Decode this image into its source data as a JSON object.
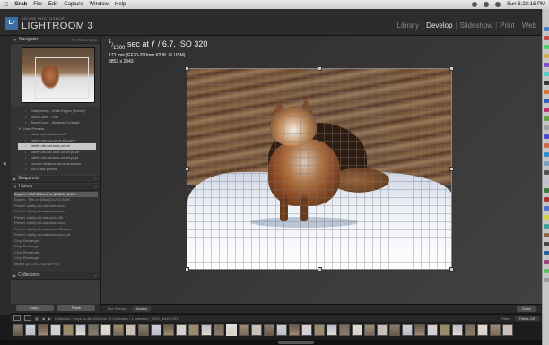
{
  "menubar": {
    "app_name": "Grab",
    "items": [
      "File",
      "Edit",
      "Capture",
      "Window",
      "Help"
    ],
    "clock": "Sun 6:23:16 PM"
  },
  "brand": {
    "logo": "Lr",
    "top_line": "ADOBE PHOTOSHOP",
    "name": "LIGHTROOM 3"
  },
  "modules": [
    {
      "label": "Library"
    },
    {
      "label": "Develop",
      "active": true
    },
    {
      "label": "Slideshow"
    },
    {
      "label": "Print"
    },
    {
      "label": "Web"
    }
  ],
  "left_panel": {
    "navigator_title": "Navigator",
    "navigator_zoom": "FIT  FILL  1:1  3:1",
    "presets": [
      {
        "label": "Sharpening - Wide Edges (Scenic)",
        "level": 1
      },
      {
        "label": "Tone Curve - Flat",
        "level": 1
      },
      {
        "label": "Tone Curve - Medium Contrast",
        "level": 1
      },
      {
        "label": "User Presets",
        "level": 0
      },
      {
        "label": "clarity-vib-sat-curve-fill",
        "level": 1
      },
      {
        "label": "clarity-vib-sat-curve-fill-conv",
        "level": 1
      },
      {
        "label": "clarity-vib-sat-tone-curve",
        "level": 1,
        "selected": true
      },
      {
        "label": "clarity-vib-sat-tone-curve-pt-pn",
        "level": 1
      },
      {
        "label": "clarity-vib-sat-tone-curve-pt-pr",
        "level": 1
      },
      {
        "label": "current wb-tone-curve-shadows",
        "level": 1
      },
      {
        "label": "pre-crack preset",
        "level": 1
      }
    ],
    "snapshots_title": "Snapshots",
    "history_title": "History",
    "history": [
      {
        "label": "Export - HDR Effect Pro (2/12/11 6:09...",
        "selected": true
      },
      {
        "label": "Export - Tiffs on Disk (2/12/11 6:09..."
      },
      {
        "label": "Preset: clarity-vib-sat-tone-curve"
      },
      {
        "label": "Preset: clarity-vib-sat-tone-curve"
      },
      {
        "label": "Preset: clarity-vib-sat-curve-fill"
      },
      {
        "label": "Preset: clarity-vib-sat-tone-curve"
      },
      {
        "label": "Preset: clarity-vib-sat-curve-fill-conv"
      },
      {
        "label": "Preset: clarity-vib-sat-tone-curve-pt"
      },
      {
        "label": "Crop Rectangle"
      },
      {
        "label": "Crop Rectangle"
      },
      {
        "label": "Crop Rectangle"
      },
      {
        "label": "Crop Rectangle"
      },
      {
        "label": "Import (2/12/11 7:44:16 PM)"
      }
    ],
    "collections_title": "Collections",
    "copy_label": "Copy...",
    "paste_label": "Paste"
  },
  "info_overlay": {
    "shutter_num": "1",
    "shutter_den": "1500",
    "line1_rest": " sec at ƒ / 6.7, ISO 320",
    "line2": "173 mm (EF70-200mm f/2.8L IS USM)",
    "line3": "3852 x 2943"
  },
  "toolbar": {
    "tool_label": "Tool Overlay :",
    "tool_value": "Always",
    "close_label": "Close"
  },
  "filmstrip_header": {
    "path": "Collection / Keys on-All-2011-fox / 1 Collection / 1 selected / _DSC_6415.CR2",
    "filter_label": "Filter :",
    "filter_value": "Filters Off"
  },
  "colors": {
    "accent": "#3b6ea5",
    "panel": "#3a3a3a",
    "active_module": "#e8e8e8",
    "inactive_module": "#8a8a8a"
  },
  "icons": [
    "apple-icon",
    "lightroom-logo-icon",
    "disclosure-triangle-icon",
    "crop-handle-icon",
    "filmstrip-thumbnail-icon"
  ]
}
